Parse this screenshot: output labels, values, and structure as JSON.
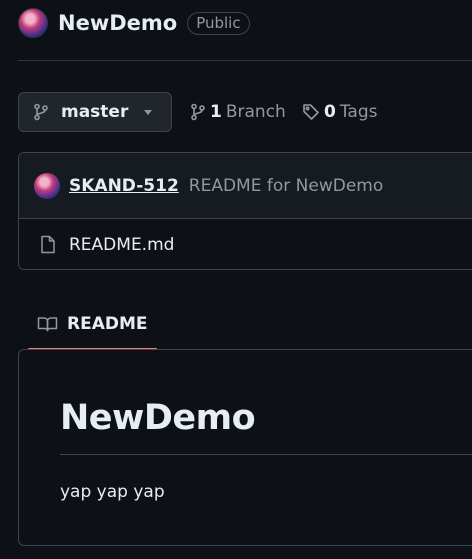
{
  "repo": {
    "name": "NewDemo",
    "visibility": "Public"
  },
  "branch_bar": {
    "current_branch": "master",
    "branch_count": "1",
    "branch_label": "Branch",
    "tag_count": "0",
    "tag_label": "Tags"
  },
  "latest_commit": {
    "author": "SKAND-512",
    "message": "README for NewDemo"
  },
  "files": [
    {
      "name": "README.md",
      "icon": "file-icon"
    }
  ],
  "readme": {
    "tab_label": "README",
    "heading": "NewDemo",
    "body": "yap yap yap"
  },
  "colors": {
    "background": "#0d1117",
    "border": "#3d444d",
    "muted_text": "#9198a1",
    "text": "#e6edf3",
    "tab_underline": "#f78166"
  }
}
